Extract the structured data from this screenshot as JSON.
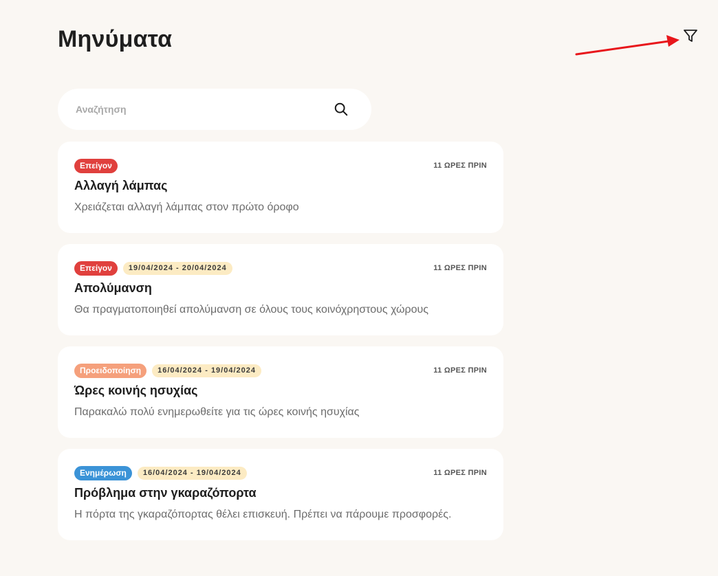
{
  "page": {
    "title": "Μηνύματα"
  },
  "filter": {
    "icon": "filter-icon"
  },
  "annotation": {
    "color": "#e8161b"
  },
  "search": {
    "placeholder": "Αναζήτηση",
    "value": "",
    "icon": "search-icon"
  },
  "colors": {
    "urgent": "#e0403d",
    "warning": "#f5a07c",
    "info": "#3b93d7",
    "date_badge": "#fcebc3",
    "background": "#faf7f3"
  },
  "messages": [
    {
      "badge": "Επείγον",
      "badge_color": "#e0403d",
      "date_range": "",
      "time_ago": "11 ΩΡΕΣ ΠΡΙΝ",
      "title": "Αλλαγή λάμπας",
      "body": "Χρειάζεται αλλαγή λάμπας στον πρώτο όροφο"
    },
    {
      "badge": "Επείγον",
      "badge_color": "#e0403d",
      "date_range": "19/04/2024 - 20/04/2024",
      "time_ago": "11 ΩΡΕΣ ΠΡΙΝ",
      "title": "Απολύμανση",
      "body": "Θα πραγματοποιηθεί απολύμανση σε όλους τους κοινόχρηστους χώρους"
    },
    {
      "badge": "Προειδοποίηση",
      "badge_color": "#f5a07c",
      "date_range": "16/04/2024 - 19/04/2024",
      "time_ago": "11 ΩΡΕΣ ΠΡΙΝ",
      "title": "Ώρες κοινής ησυχίας",
      "body": "Παρακαλώ πολύ ενημερωθείτε για τις ώρες κοινής ησυχίας"
    },
    {
      "badge": "Ενημέρωση",
      "badge_color": "#3b93d7",
      "date_range": "16/04/2024 - 19/04/2024",
      "time_ago": "11 ΩΡΕΣ ΠΡΙΝ",
      "title": "Πρόβλημα στην γκαραζόπορτα",
      "body": "Η πόρτα της γκαραζόπορτας θέλει επισκευή. Πρέπει να πάρουμε προσφορές."
    }
  ]
}
